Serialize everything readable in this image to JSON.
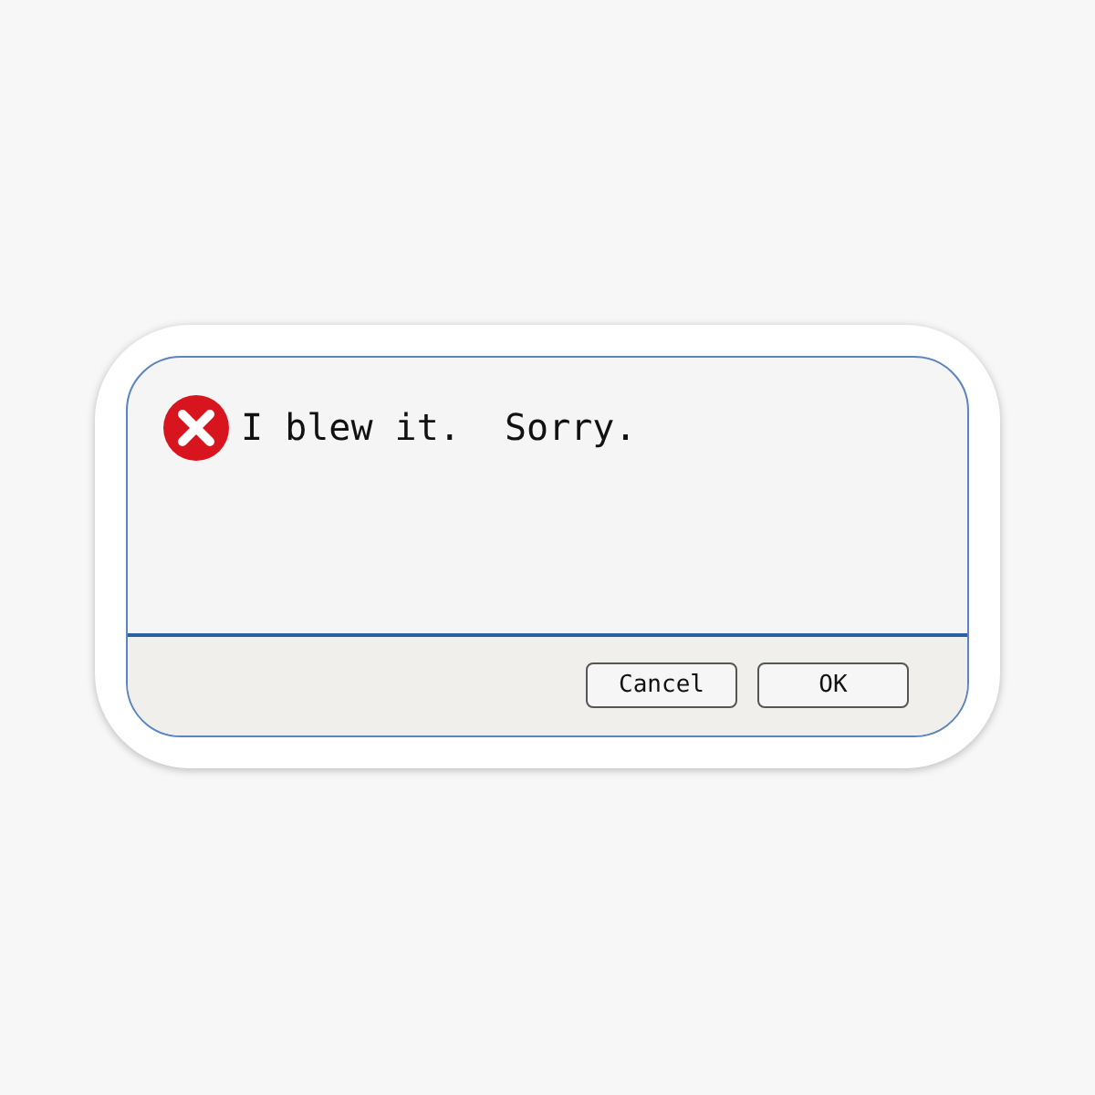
{
  "dialog": {
    "kind": "error",
    "message": "I blew it.  Sorry.",
    "buttons": [
      {
        "label": "Cancel"
      },
      {
        "label": "OK"
      }
    ]
  }
}
